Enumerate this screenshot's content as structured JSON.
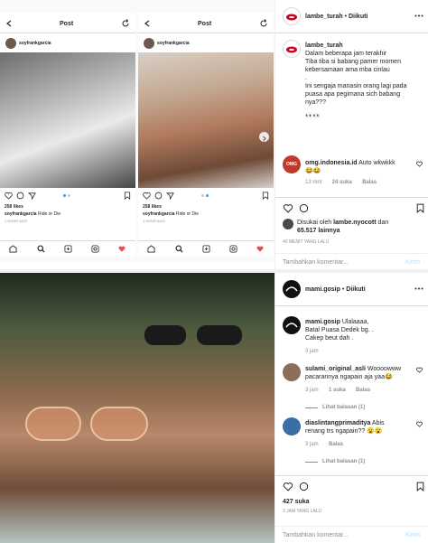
{
  "top_left": {
    "phone_a": {
      "header": "Post",
      "username": "soyfrankgarcia",
      "likes": "258 likes",
      "caption_user": "soyfrankgarcia",
      "caption_text": "Ride or Die",
      "date": "1 HOUR AGO"
    },
    "phone_b": {
      "header": "Post",
      "username": "soyfrankgarcia",
      "likes": "258 likes",
      "caption_user": "soyfrankgarcia",
      "caption_text": "Ride or Die",
      "date": "1 HOUR AGO"
    }
  },
  "top_right": {
    "account": "lambe_turah",
    "follow_sep": "•",
    "follow": "Diikuti",
    "caption_user": "lambe_turah",
    "caption_lines": [
      "Dalam beberapa jam terakhir",
      "Tiba tiba si babang pamer momen",
      "kebersamaan ama mba cinlau",
      ".",
      "Ini sengaja manasin orang lagi pada",
      "puasa apa pegimana sich babang",
      "nya???"
    ],
    "caption_emoji": "👀👀",
    "comment": {
      "user": "omg.indonesia.id",
      "text": "Auto wkwkkk",
      "emoji": "😂😂",
      "time": "13 mnt",
      "likes": "24 suka",
      "reply": "Balas"
    },
    "liked_by_prefix": "Disukai oleh",
    "liked_by_user": "lambe.nyocott",
    "liked_by_suffix": "dan",
    "liked_by_count": "65.517 lainnya",
    "timestamp": "40 MENIT YANG LALU",
    "input_placeholder": "Tambahkan komentar...",
    "post_button": "Kirim"
  },
  "bottom_right": {
    "account": "mami.gosip",
    "follow_sep": "•",
    "follow": "Diikuti",
    "caption_user": "mami.gosip",
    "caption_lines": [
      "Ulalaaaa,",
      "Batal Puasa Dedek bg. .",
      "Cakep beut dah ."
    ],
    "caption_time": "3 jam",
    "comments": [
      {
        "user": "sulami_original_asli",
        "text_lines": [
          "Woooowww",
          "pacarannya ngapain aja yaa😂"
        ],
        "time": "3 jam",
        "likes": "1 suka",
        "reply": "Balas",
        "view_replies": "Lihat balasan (1)"
      },
      {
        "user": "diaslintangprimaditya",
        "text_lines": [
          "Abis",
          "renang trs ngapain?? 😮😮"
        ],
        "time": "3 jam",
        "likes": "",
        "reply": "Balas",
        "view_replies": "Lihat balasan (1)"
      }
    ],
    "likes": "427 suka",
    "timestamp": "3 JAM YANG LALU",
    "input_placeholder": "Tambahkan komentar...",
    "post_button": "Kirim"
  },
  "colors": {
    "link_blue": "#3897f0",
    "heart_red": "#ed4956",
    "text": "#262626",
    "muted": "#8e8e8e"
  }
}
